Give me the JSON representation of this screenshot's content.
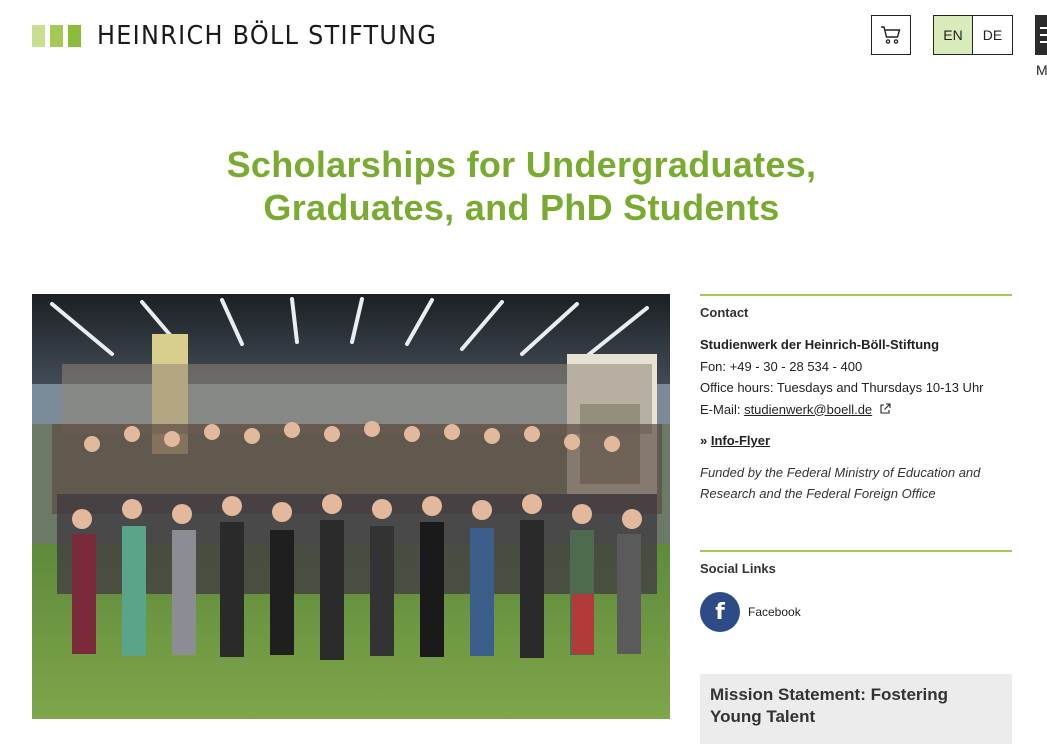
{
  "header": {
    "logo_text": "HEINRICH BÖLL STIFTUNG",
    "lang_en": "EN",
    "lang_de": "DE",
    "menu_label": "M"
  },
  "page": {
    "title_line1": "Scholarships for Undergraduates,",
    "title_line2": "Graduates, and PhD Students"
  },
  "sidebar": {
    "contact_heading": "Contact",
    "org": "Studienwerk der Heinrich-Böll-Stiftung",
    "phone": "Fon: +49 - 30 - 28 534 - 400",
    "hours": "Office hours: Tuesdays and Thursdays 10-13 Uhr",
    "email_label": "E-Mail: ",
    "email": "studienwerk@boell.de",
    "info_prefix": "» ",
    "info_link": "Info-Flyer",
    "funded": "Funded by the Federal Ministry of Education and Research and the Federal Foreign Office",
    "social_heading": "Social Links",
    "facebook": "Facebook",
    "mission_title": "Mission Statement: Fostering Young Talent"
  },
  "colors": {
    "accent_green": "#7aab31",
    "logo_green": "#a4c954",
    "active_lang_bg": "#d9eabb",
    "facebook_blue": "#2e4b85"
  },
  "icons": [
    "cart-icon",
    "external-link-icon",
    "facebook-icon",
    "menu-icon"
  ]
}
